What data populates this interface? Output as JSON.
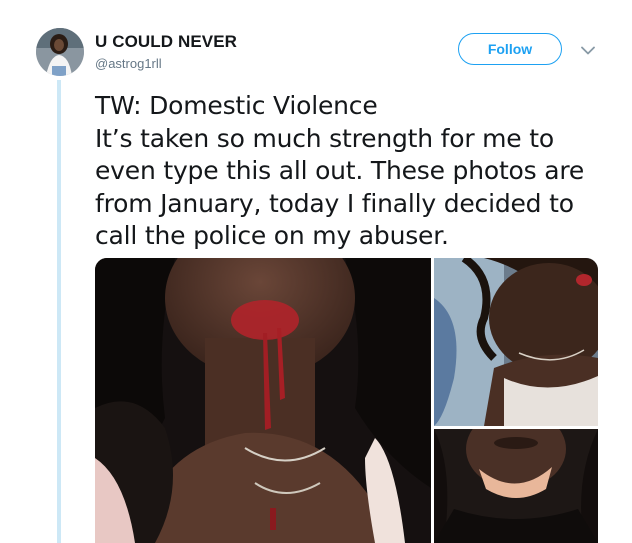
{
  "author": {
    "display_name": "U COULD NEVER",
    "handle": "@astrog1rll"
  },
  "actions": {
    "follow_label": "Follow",
    "more_icon": "chevron-down-icon"
  },
  "tweet": {
    "lines": [
      "TW: Domestic Violence",
      "It’s taken so much strength for me to",
      "even type this all out. These photos are",
      "from January, today I finally decided to",
      "call the police on my abuser."
    ]
  },
  "colors": {
    "accent": "#1da1f2",
    "text_primary": "#14171a",
    "text_secondary": "#657786",
    "thread_line": "#cde8f6"
  }
}
